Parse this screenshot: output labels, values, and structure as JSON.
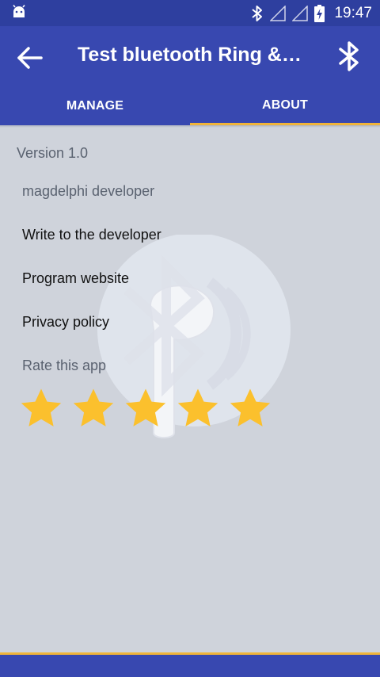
{
  "status_bar": {
    "time": "19:47",
    "icons": [
      "android-notification-icon",
      "bluetooth-icon",
      "signal-icon",
      "signal-icon",
      "battery-charging-icon"
    ]
  },
  "toolbar": {
    "title": "Test bluetooth Ring &…",
    "back_icon": "arrow-back-icon",
    "action_icon": "bluetooth-icon"
  },
  "tabs": [
    {
      "label": "MANAGE",
      "active": false
    },
    {
      "label": "ABOUT",
      "active": true
    }
  ],
  "about": {
    "version": "Version 1.0",
    "developer": "magdelphi developer",
    "write_label": "Write to the developer",
    "website_label": "Program website",
    "privacy_label": "Privacy policy",
    "rate_label": "Rate this app",
    "rating": 5,
    "max_rating": 5
  },
  "colors": {
    "primary": "#3848b0",
    "primary_dark": "#2e3f9f",
    "accent": "#f0b43a",
    "star": "#fbc02d",
    "background": "#cfd3db"
  }
}
